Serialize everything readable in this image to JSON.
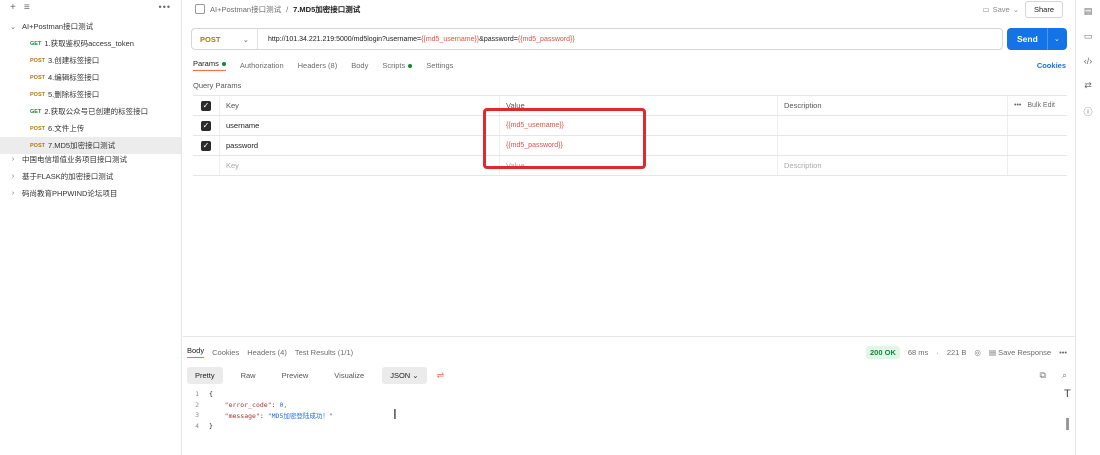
{
  "sidebar": {
    "items": [
      {
        "label": "AI+Postman接口测试",
        "chevron": "⌄",
        "method": "",
        "level": 0
      },
      {
        "label": "1.获取鉴权码access_token",
        "method": "GET",
        "level": 2
      },
      {
        "label": "3.创建标签接口",
        "method": "POST",
        "level": 2
      },
      {
        "label": "4.编辑标签接口",
        "method": "POST",
        "level": 2
      },
      {
        "label": "5.删除标签接口",
        "method": "POST",
        "level": 2
      },
      {
        "label": "2.获取公众号已创建的标签接口",
        "method": "GET",
        "level": 2
      },
      {
        "label": "6.文件上传",
        "method": "POST",
        "level": 2
      },
      {
        "label": "7.MD5加密接口测试",
        "method": "POST",
        "level": 2
      },
      {
        "label": "中国电信增值业务项目接口测试",
        "chevron": "›",
        "method": "",
        "level": 0
      },
      {
        "label": "基于FLASK的加密接口测试",
        "chevron": "›",
        "method": "",
        "level": 0
      },
      {
        "label": "码尚教育PHPWIND论坛项目",
        "chevron": "›",
        "method": "",
        "level": 0
      }
    ]
  },
  "header": {
    "breadcrumb_parent": "AI+Postman接口测试",
    "breadcrumb_sep": "/",
    "breadcrumb_current": "7.MD5加密接口测试",
    "save_label": "Save",
    "share_label": "Share"
  },
  "request": {
    "method": "POST",
    "url_prefix": "http://101.34.221.219:5000/md5login?username=",
    "url_var1": "{{md5_username}}",
    "url_mid": "&password=",
    "url_var2": "{{md5_password}}",
    "send_label": "Send"
  },
  "request_tabs": {
    "params": "Params",
    "authorization": "Authorization",
    "headers": "Headers (8)",
    "body": "Body",
    "scripts": "Scripts",
    "settings": "Settings",
    "cookies": "Cookies"
  },
  "params": {
    "title": "Query Params",
    "headers": {
      "key": "Key",
      "value": "Value",
      "description": "Description",
      "bulk_edit": "Bulk Edit"
    },
    "rows": [
      {
        "key": "username",
        "value": "{{md5_username}}",
        "description": ""
      },
      {
        "key": "password",
        "value": "{{md5_password}}",
        "description": ""
      }
    ],
    "placeholder": {
      "key": "Key",
      "value": "Value",
      "description": "Description"
    }
  },
  "response": {
    "tabs": {
      "body": "Body",
      "cookies": "Cookies",
      "headers": "Headers (4)",
      "test_results": "Test Results (1/1)"
    },
    "status": "200 OK",
    "time": "68 ms",
    "size": "221 B",
    "save_response": "Save Response",
    "formats": {
      "pretty": "Pretty",
      "raw": "Raw",
      "preview": "Preview",
      "visualize": "Visualize",
      "json": "JSON"
    },
    "code_lines": [
      {
        "n": "1",
        "text": "{"
      },
      {
        "n": "2",
        "key": "\"error_code\"",
        "val": " 0,"
      },
      {
        "n": "3",
        "key": "\"message\"",
        "val": " \"MD5加密登陆成功！\""
      },
      {
        "n": "4",
        "text": "}"
      }
    ]
  },
  "colors": {
    "accent": "#ff6c37",
    "send": "#1473e6",
    "highlight": "#e02a2a"
  }
}
